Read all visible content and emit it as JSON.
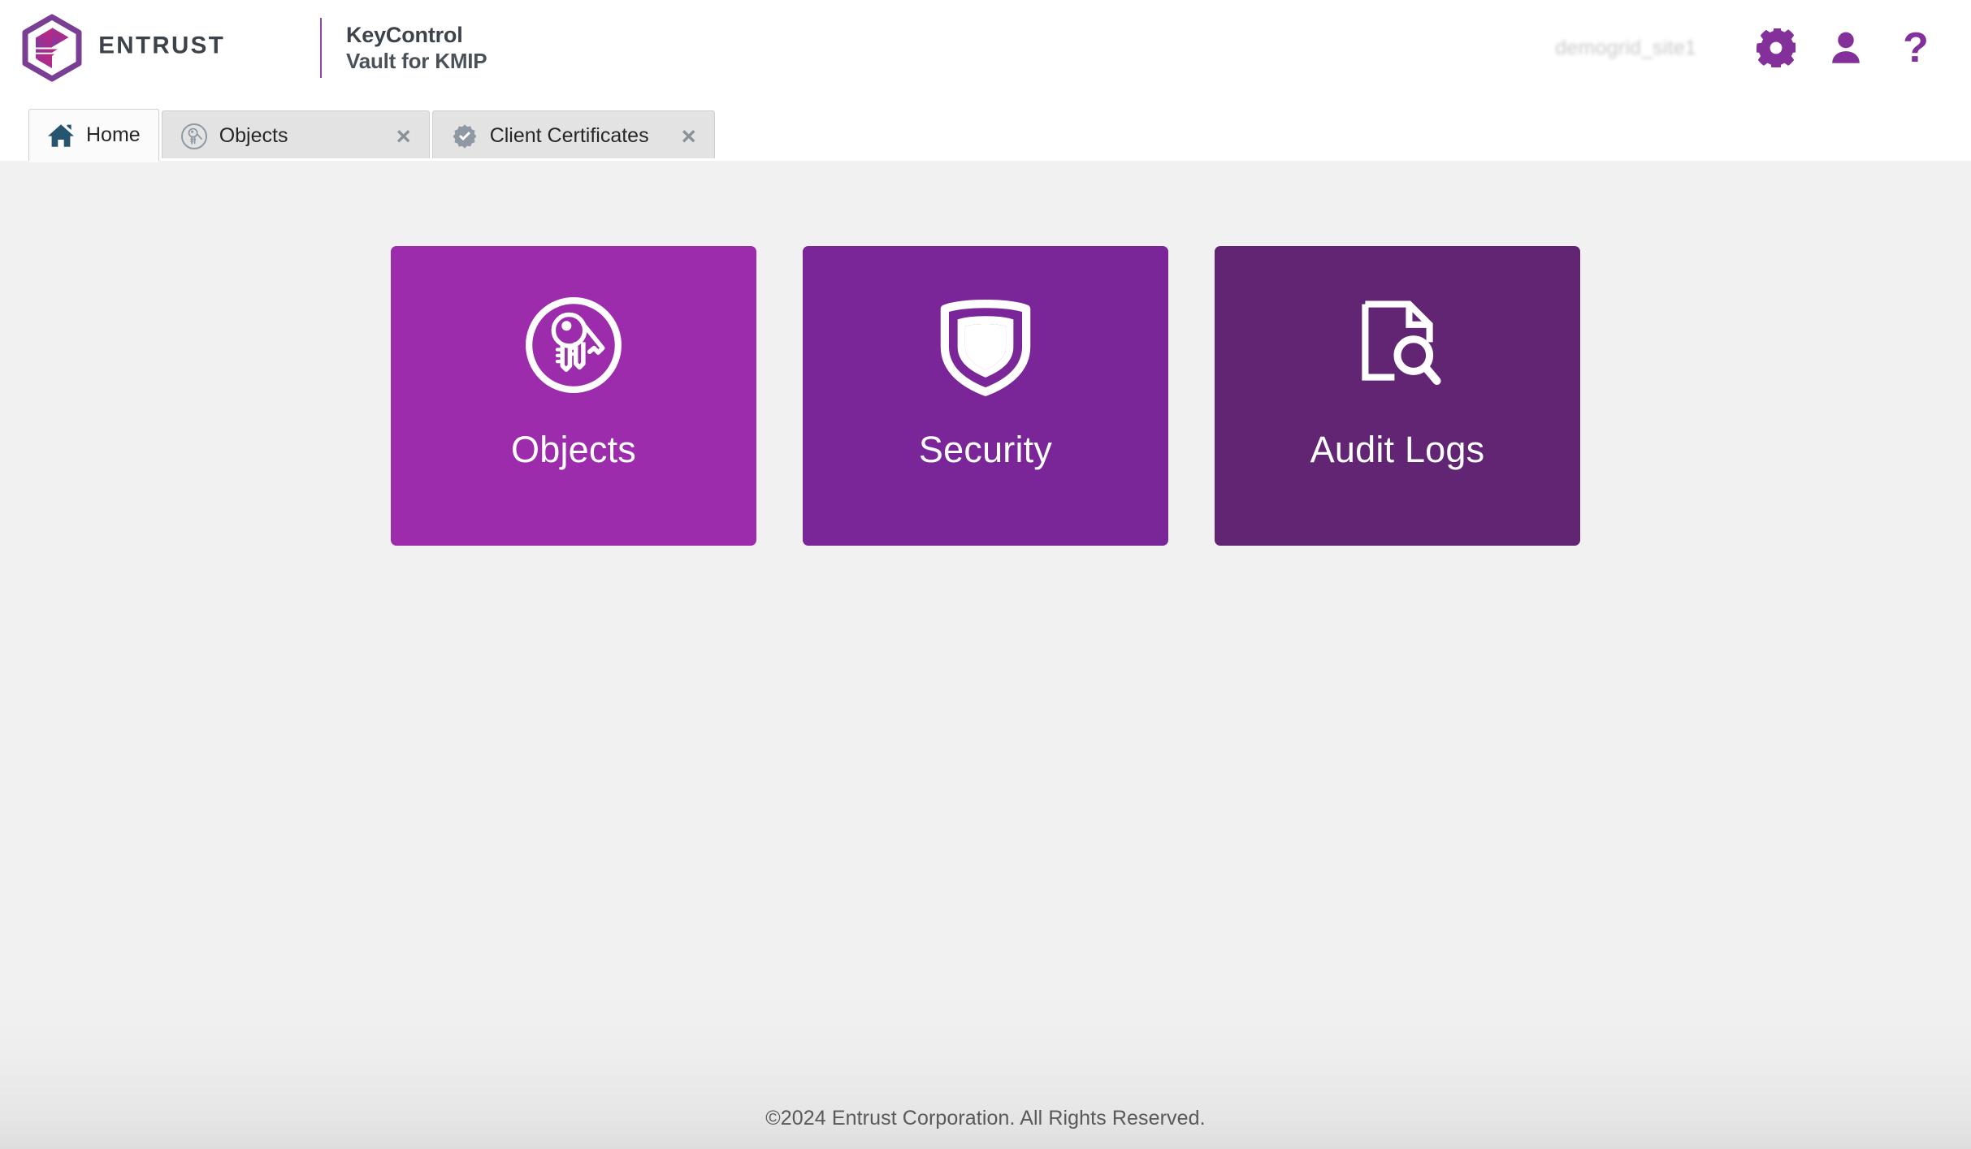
{
  "header": {
    "logo_alt": "Entrust",
    "wordmark": "ENTRUST",
    "product_line1": "KeyControl",
    "product_line2": "Vault for KMIP",
    "tenant": "demogrid_site1",
    "settings_icon": "gear-icon",
    "user_icon": "user-icon",
    "help_icon": "question-mark-icon",
    "help_label": "?",
    "brand_purple": "#84309a",
    "text_dark": "#3d434a"
  },
  "tabs": [
    {
      "label": "Home",
      "icon": "home-icon",
      "active": true,
      "closable": false
    },
    {
      "label": "Objects",
      "icon": "keyring-circle-icon",
      "active": false,
      "closable": true,
      "close_label": "×"
    },
    {
      "label": "Client Certificates",
      "icon": "certificate-badge-icon",
      "active": false,
      "closable": true,
      "close_label": "×"
    }
  ],
  "main": {
    "tiles": [
      {
        "label": "Objects",
        "icon": "keyring-circle-icon",
        "color": "#9c2cac"
      },
      {
        "label": "Security",
        "icon": "shield-icon",
        "color": "#7a2699"
      },
      {
        "label": "Audit Logs",
        "icon": "document-search-icon",
        "color": "#622573"
      }
    ]
  },
  "footer": {
    "copyright": "©2024 Entrust Corporation. All Rights Reserved."
  }
}
